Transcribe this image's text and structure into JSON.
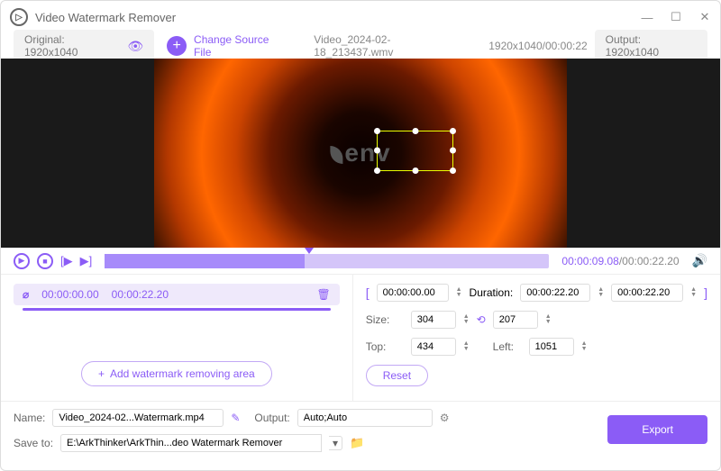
{
  "app": {
    "title": "Video Watermark Remover"
  },
  "toolbar": {
    "original_label": "Original:  1920x1040",
    "change_source": "Change Source File",
    "file_name": "Video_2024-02-18_213437.wmv",
    "file_meta": "1920x1040/00:00:22",
    "output_label": "Output:  1920x1040"
  },
  "preview": {
    "watermark_text": "env"
  },
  "playback": {
    "current": "00:00:09.08",
    "total": "/00:00:22.20"
  },
  "segment": {
    "start": "00:00:00.00",
    "end": "00:00:22.20"
  },
  "add_area_label": "Add watermark removing area",
  "props": {
    "range_start": "00:00:00.00",
    "duration_label": "Duration:",
    "duration": "00:00:22.20",
    "range_end": "00:00:22.20",
    "size_label": "Size:",
    "size_w": "304",
    "size_h": "207",
    "top_label": "Top:",
    "top": "434",
    "left_label": "Left:",
    "left": "1051",
    "reset": "Reset"
  },
  "bottom": {
    "name_label": "Name:",
    "name_value": "Video_2024-02...Watermark.mp4",
    "output_label": "Output:",
    "output_value": "Auto;Auto",
    "save_label": "Save to:",
    "save_value": "E:\\ArkThinker\\ArkThin...deo Watermark Remover",
    "export": "Export"
  }
}
